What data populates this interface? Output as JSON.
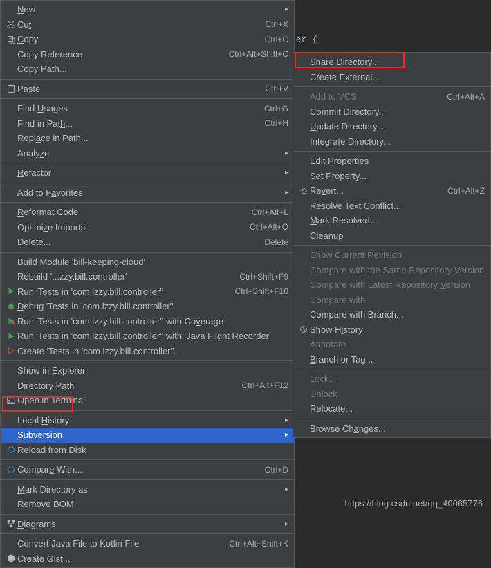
{
  "bgcode": "ler {",
  "watermark": "https://blog.csdn.net/qq_40065776",
  "menu": [
    {
      "icon": "",
      "label_html": "<span class='underline'>N</span>ew",
      "shortcut": "",
      "arrow": true
    },
    {
      "icon": "cut",
      "label_html": "Cu<span class='underline'>t</span>",
      "shortcut": "Ctrl+X"
    },
    {
      "icon": "copy",
      "label_html": "<span class='underline'>C</span>opy",
      "shortcut": "Ctrl+C"
    },
    {
      "icon": "",
      "label_html": "Copy Reference",
      "shortcut": "Ctrl+Alt+Shift+C"
    },
    {
      "icon": "",
      "label_html": "Cop<span class='underline'>y</span> Path...",
      "shortcut": ""
    },
    {
      "sep": true
    },
    {
      "icon": "paste",
      "label_html": "<span class='underline'>P</span>aste",
      "shortcut": "Ctrl+V"
    },
    {
      "sep": true
    },
    {
      "icon": "",
      "label_html": "Find <span class='underline'>U</span>sages",
      "shortcut": "Ctrl+G"
    },
    {
      "icon": "",
      "label_html": "Find in Pat<span class='underline'>h</span>...",
      "shortcut": "Ctrl+H"
    },
    {
      "icon": "",
      "label_html": "Repl<span class='underline'>a</span>ce in Path...",
      "shortcut": ""
    },
    {
      "icon": "",
      "label_html": "Analy<span class='underline'>z</span>e",
      "shortcut": "",
      "arrow": true
    },
    {
      "sep": true
    },
    {
      "icon": "",
      "label_html": "<span class='underline'>R</span>efactor",
      "shortcut": "",
      "arrow": true
    },
    {
      "sep": true
    },
    {
      "icon": "",
      "label_html": "Add to F<span class='underline'>a</span>vorites",
      "shortcut": "",
      "arrow": true
    },
    {
      "sep": true
    },
    {
      "icon": "",
      "label_html": "<span class='underline'>R</span>eformat Code",
      "shortcut": "Ctrl+Alt+L"
    },
    {
      "icon": "",
      "label_html": "Optimi<span class='underline'>z</span>e Imports",
      "shortcut": "Ctrl+Alt+O"
    },
    {
      "icon": "",
      "label_html": "<span class='underline'>D</span>elete...",
      "shortcut": "Delete"
    },
    {
      "sep": true
    },
    {
      "icon": "",
      "label_html": "Build <span class='underline'>M</span>odule 'bill-keeping-cloud'",
      "shortcut": ""
    },
    {
      "icon": "",
      "label_html": "Rebuild '...zzy.bill.controller'",
      "shortcut": "Ctrl+Shift+F9"
    },
    {
      "icon": "run",
      "label_html": "Run 'Tests in 'com.lzzy.bill.controller''",
      "shortcut": "Ctrl+Shift+F10"
    },
    {
      "icon": "debug",
      "label_html": "<span class='underline'>D</span>ebug 'Tests in 'com.lzzy.bill.controller''",
      "shortcut": ""
    },
    {
      "icon": "coverage",
      "label_html": "Run 'Tests in 'com.lzzy.bill.controller'' with Co<span class='underline'>v</span>erage",
      "shortcut": ""
    },
    {
      "icon": "run",
      "label_html": "Run 'Tests in 'com.lzzy.bill.controller'' with 'Java Flight Recorder'",
      "shortcut": ""
    },
    {
      "icon": "create",
      "label_html": "Create 'Tests in 'com.lzzy.bill.controller''...",
      "shortcut": ""
    },
    {
      "sep": true
    },
    {
      "icon": "",
      "label_html": "Show in Explorer",
      "shortcut": ""
    },
    {
      "icon": "",
      "label_html": "Directory <span class='underline'>P</span>ath",
      "shortcut": "Ctrl+Alt+F12"
    },
    {
      "icon": "terminal",
      "label_html": "Open in Terminal",
      "shortcut": ""
    },
    {
      "sep": true
    },
    {
      "icon": "",
      "label_html": "Local <span class='underline'>H</span>istory",
      "shortcut": "",
      "arrow": true
    },
    {
      "icon": "",
      "label_html": "<span class='underline'>S</span>ubversion",
      "shortcut": "",
      "arrow": true,
      "selected": true
    },
    {
      "icon": "reload",
      "label_html": "Reload from Disk",
      "shortcut": ""
    },
    {
      "sep": true
    },
    {
      "icon": "compare",
      "label_html": "Compar<span class='underline'>e</span> With...",
      "shortcut": "Ctrl+D"
    },
    {
      "sep": true
    },
    {
      "icon": "",
      "label_html": "<span class='underline'>M</span>ark Directory as",
      "shortcut": "",
      "arrow": true
    },
    {
      "icon": "",
      "label_html": "Remove BOM",
      "shortcut": ""
    },
    {
      "sep": true
    },
    {
      "icon": "diagram",
      "label_html": "<span class='underline'>D</span>iagrams",
      "shortcut": "",
      "arrow": true
    },
    {
      "sep": true
    },
    {
      "icon": "",
      "label_html": "Convert Java File to Kotlin File",
      "shortcut": "Ctrl+Alt+Shift+K"
    },
    {
      "icon": "github",
      "label_html": "Create Gist...",
      "shortcut": ""
    }
  ],
  "submenu": [
    {
      "label_html": "<span class='underline'>S</span>hare Directory..."
    },
    {
      "label_html": "Create External..."
    },
    {
      "sep": true
    },
    {
      "label_html": "Add to VCS",
      "shortcut": "Ctrl+Alt+A",
      "disabled": true
    },
    {
      "label_html": "Commit Directory..."
    },
    {
      "label_html": "<span class='underline'>U</span>pdate Directory..."
    },
    {
      "label_html": "Integrate Directory..."
    },
    {
      "sep": true
    },
    {
      "label_html": "Edit <span class='underline'>P</span>roperties"
    },
    {
      "label_html": "Set Property..."
    },
    {
      "icon": "revert",
      "label_html": "Re<span class='underline'>v</span>ert...",
      "shortcut": "Ctrl+Alt+Z"
    },
    {
      "label_html": "Resolve Text Conflict..."
    },
    {
      "label_html": "<span class='underline'>M</span>ark Resolved..."
    },
    {
      "label_html": "Cleanup"
    },
    {
      "sep": true
    },
    {
      "label_html": "Show Current Revision",
      "disabled": true
    },
    {
      "label_html": "Compare with the Same Repository Version",
      "disabled": true
    },
    {
      "label_html": "Compare with Latest Repository <span class='underline'>V</span>ersion",
      "disabled": true
    },
    {
      "label_html": "Compare with...",
      "disabled": true
    },
    {
      "label_html": "Compare with Branch..."
    },
    {
      "icon": "history",
      "label_html": "Show H<span class='underline'>i</span>story"
    },
    {
      "label_html": "Annotate",
      "disabled": true
    },
    {
      "label_html": "<span class='underline'>B</span>ranch or Tag..."
    },
    {
      "sep": true
    },
    {
      "label_html": "<span class='underline'>L</span>ock...",
      "disabled": true
    },
    {
      "label_html": "Unl<span class='underline'>o</span>ck",
      "disabled": true
    },
    {
      "label_html": "Relocate..."
    },
    {
      "sep": true
    },
    {
      "label_html": "Browse Ch<span class='underline'>a</span>nges..."
    }
  ]
}
